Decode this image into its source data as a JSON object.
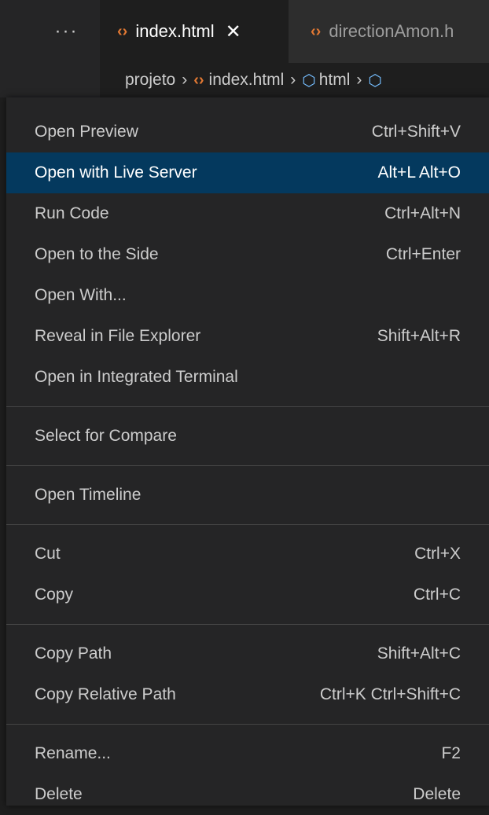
{
  "tabs": {
    "more": "···",
    "active": {
      "label": "index.html",
      "icon": "html-file-icon",
      "close": "✕"
    },
    "inactive": {
      "label": "directionAmon.h",
      "icon": "html-file-icon"
    }
  },
  "breadcrumb": {
    "items": [
      "projeto",
      "index.html",
      "html"
    ]
  },
  "menu": {
    "groups": [
      [
        {
          "label": "Open Preview",
          "shortcut": "Ctrl+Shift+V"
        },
        {
          "label": "Open with Live Server",
          "shortcut": "Alt+L Alt+O",
          "highlighted": true
        },
        {
          "label": "Run Code",
          "shortcut": "Ctrl+Alt+N"
        },
        {
          "label": "Open to the Side",
          "shortcut": "Ctrl+Enter"
        },
        {
          "label": "Open With...",
          "shortcut": ""
        },
        {
          "label": "Reveal in File Explorer",
          "shortcut": "Shift+Alt+R"
        },
        {
          "label": "Open in Integrated Terminal",
          "shortcut": ""
        }
      ],
      [
        {
          "label": "Select for Compare",
          "shortcut": ""
        }
      ],
      [
        {
          "label": "Open Timeline",
          "shortcut": ""
        }
      ],
      [
        {
          "label": "Cut",
          "shortcut": "Ctrl+X"
        },
        {
          "label": "Copy",
          "shortcut": "Ctrl+C"
        }
      ],
      [
        {
          "label": "Copy Path",
          "shortcut": "Shift+Alt+C"
        },
        {
          "label": "Copy Relative Path",
          "shortcut": "Ctrl+K Ctrl+Shift+C"
        }
      ],
      [
        {
          "label": "Rename...",
          "shortcut": "F2"
        },
        {
          "label": "Delete",
          "shortcut": "Delete"
        }
      ]
    ]
  },
  "colors": {
    "highlight": "#04395e",
    "html_icon": "#e37933",
    "symbol_icon": "#75beff"
  }
}
